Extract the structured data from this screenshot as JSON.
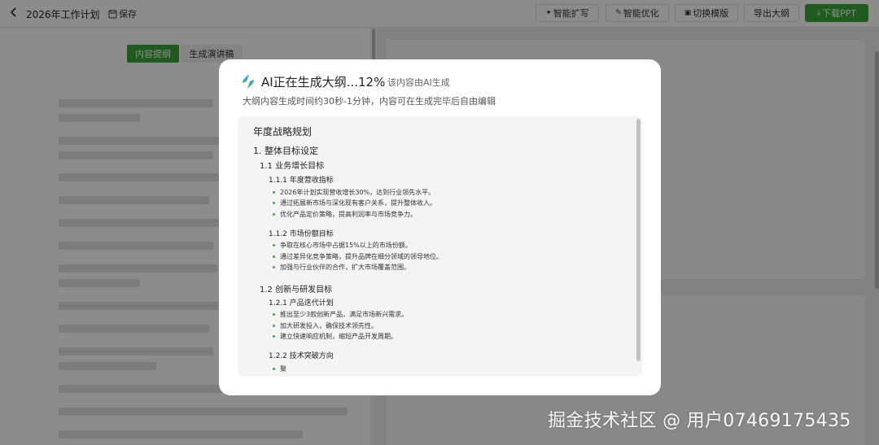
{
  "header": {
    "doc_title": "2026年工作计划",
    "save_label": "保存",
    "buttons": {
      "expand": "智能扩写",
      "optimize": "智能优化",
      "template": "切换模版",
      "export_outline": "导出大纲",
      "download_ppt": "下载PPT"
    }
  },
  "left_panel": {
    "tabs": [
      "内容提纲",
      "生成演讲稿"
    ]
  },
  "modal": {
    "title": "AI正在生成大纲...12%",
    "badge": "该内容由AI生成",
    "subtitle": "大纲内容生成时间约30秒-1分钟，内容可在生成完毕后自由编辑",
    "progress_percent": 12,
    "outline": [
      {
        "level": "h0",
        "text": "年度战略规划"
      },
      {
        "level": "h1",
        "text": "1. 整体目标设定"
      },
      {
        "level": "h2",
        "text": "1.1 业务增长目标"
      },
      {
        "level": "h3",
        "text": "1.1.1 年度营收指标"
      },
      {
        "level": "b",
        "text": "2026年计划实现营收增长30%，达到行业领先水平。"
      },
      {
        "level": "b",
        "text": "通过拓展新市场与深化现有客户关系，提升整体收入。"
      },
      {
        "level": "b",
        "text": "优化产品定价策略，提高利润率与市场竞争力。"
      },
      {
        "level": "h3",
        "text": "1.1.2 市场份额目标"
      },
      {
        "level": "b",
        "text": "争取在核心市场中占据15%以上的市场份额。"
      },
      {
        "level": "b",
        "text": "通过差异化竞争策略，提升品牌在细分领域的领导地位。"
      },
      {
        "level": "b",
        "text": "加强与行业伙伴的合作，扩大市场覆盖范围。"
      },
      {
        "level": "h2",
        "text": "1.2 创新与研发目标"
      },
      {
        "level": "h3",
        "text": "1.2.1 产品迭代计划"
      },
      {
        "level": "b",
        "text": "推出至少3款创新产品，满足市场新兴需求。"
      },
      {
        "level": "b",
        "text": "加大研发投入，确保技术领先性。"
      },
      {
        "level": "b",
        "text": "建立快速响应机制，缩短产品开发周期。"
      },
      {
        "level": "h3",
        "text": "1.2.2 技术突破方向"
      },
      {
        "level": "b",
        "text": "聚"
      }
    ]
  },
  "watermark": "掘金技术社区 @ 用户07469175435",
  "colors": {
    "accent": "#3aa53a",
    "overlay": "rgba(0,0,0,0.45)"
  }
}
